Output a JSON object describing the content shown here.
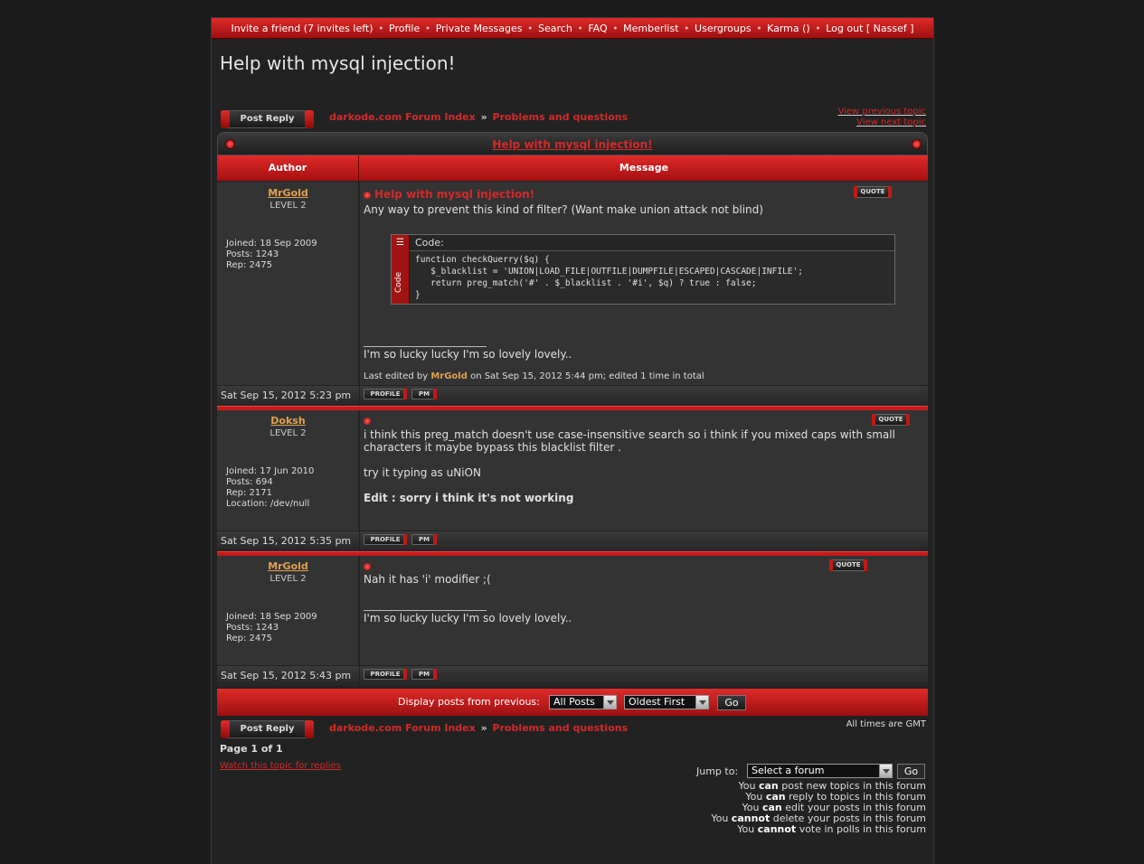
{
  "nav": {
    "invite": "Invite a friend (7 invites left)",
    "profile": "Profile",
    "pm": "Private Messages",
    "search": "Search",
    "faq": "FAQ",
    "memberlist": "Memberlist",
    "usergroups": "Usergroups",
    "karma": "Karma ()",
    "logout": "Log out [ Nassef ]",
    "sep": "•"
  },
  "topic": {
    "title": "Help with mysql injection!",
    "post_reply_label": "Post Reply",
    "breadcrumb_index": "darkode.com Forum Index",
    "breadcrumb_arrow": "»",
    "breadcrumb_forum": "Problems and questions",
    "view_previous": "View previous topic",
    "view_next": "View next topic",
    "header_title": "Help with mysql injection!"
  },
  "columns": {
    "author": "Author",
    "message": "Message"
  },
  "buttons": {
    "quote": "QUOTE",
    "profile": "PROFILE",
    "pm": "PM"
  },
  "posts": [
    {
      "author": "MrGold",
      "level": "LEVEL 2",
      "joined": "Joined: 18 Sep 2009",
      "posts": "Posts: 1243",
      "rep": "Rep: 2475",
      "subject": "Help with mysql injection!",
      "text": "Any way to prevent this kind of filter? (Want make union attack not blind)",
      "code_label": "Code:",
      "code_side": "Code",
      "code": "function checkQuerry($q) {\n   $_blacklist = 'UNION|LOAD_FILE|OUTFILE|DUMPFILE|ESCAPED|CASCADE|INFILE';\n   return preg_match('#' . $_blacklist . '#i', $q) ? true : false;\n}",
      "signature": "I'm so lucky lucky I'm so lovely lovely..",
      "edited_prefix": "Last edited by",
      "edited_user": "MrGold",
      "edited_suffix": "on Sat Sep 15, 2012 5:44 pm; edited 1 time in total",
      "date": "Sat Sep 15, 2012 5:23 pm"
    },
    {
      "author": "Doksh",
      "level": "LEVEL 2",
      "joined": "Joined: 17 Jun 2010",
      "posts": "Posts: 694",
      "rep": "Rep: 2171",
      "location": "Location: /dev/null",
      "text1": "i think this preg_match doesn't use case-insensitive search so i think if you mixed caps with small characters it maybe bypass this blacklist filter .",
      "text2": "try it typing as uNiON",
      "text3": "Edit : sorry i think it's not working",
      "date": "Sat Sep 15, 2012 5:35 pm"
    },
    {
      "author": "MrGold",
      "level": "LEVEL 2",
      "joined": "Joined: 18 Sep 2009",
      "posts": "Posts: 1243",
      "rep": "Rep: 2475",
      "text": "Nah it has 'i' modifier ;(",
      "signature": "I'm so lucky lucky I'm so lovely lovely..",
      "date": "Sat Sep 15, 2012 5:43 pm"
    }
  ],
  "display": {
    "label": "Display posts from previous:",
    "range": "All Posts",
    "order": "Oldest First",
    "go": "Go"
  },
  "footer": {
    "timezone": "All times are GMT",
    "page": "Page 1 of 1",
    "watch": "Watch this topic for replies",
    "jump_label": "Jump to:",
    "jump_select": "Select a forum",
    "jump_go": "Go",
    "perms": [
      {
        "pre": "You",
        "b": "can",
        "post": "post new topics in this forum"
      },
      {
        "pre": "You",
        "b": "can",
        "post": "reply to topics in this forum"
      },
      {
        "pre": "You",
        "b": "can",
        "post": "edit your posts in this forum"
      },
      {
        "pre": "You",
        "b": "cannot",
        "post": "delete your posts in this forum"
      },
      {
        "pre": "You",
        "b": "cannot",
        "post": "vote in polls in this forum"
      }
    ]
  },
  "colors": {
    "accent": "#d12a2a",
    "username": "#e0a050",
    "background": "#222222"
  }
}
